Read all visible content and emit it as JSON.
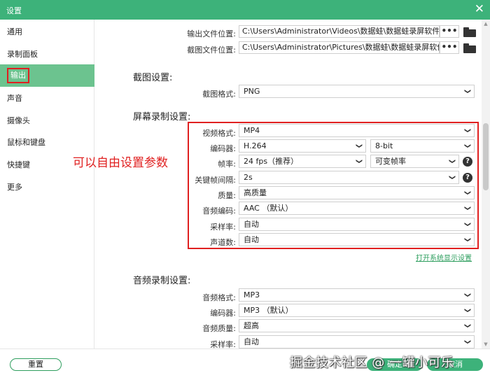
{
  "window": {
    "title": "设置",
    "close_glyph": "✕",
    "accent_color": "#3db27a"
  },
  "sidebar": {
    "items": [
      {
        "label": "通用"
      },
      {
        "label": "录制面板"
      },
      {
        "label": "输出",
        "active": true
      },
      {
        "label": "声音"
      },
      {
        "label": "摄像头"
      },
      {
        "label": "鼠标和键盘"
      },
      {
        "label": "快捷键"
      },
      {
        "label": "更多"
      }
    ]
  },
  "paths": {
    "output_label": "输出文件位置:",
    "output_value": "C:\\Users\\Administrator\\Videos\\数据蛙\\数据蛙录屏软件",
    "screenshot_label": "截图文件位置:",
    "screenshot_value": "C:\\Users\\Administrator\\Pictures\\数据蛙\\数据蛙录屏软件",
    "browse_glyph": "•••"
  },
  "screenshot_settings": {
    "title": "截图设置:",
    "format_label": "截图格式:",
    "format_value": "PNG"
  },
  "screen_recording": {
    "title": "屏幕录制设置:",
    "video_format_label": "视频格式:",
    "video_format_value": "MP4",
    "encoder_label": "编码器:",
    "encoder_value": "H.264",
    "bitdepth_value": "8-bit",
    "framerate_label": "帧率:",
    "framerate_value": "24 fps（推荐）",
    "framerate_mode_value": "可变帧率",
    "keyframe_label": "关键帧间隔:",
    "keyframe_value": "2s",
    "quality_label": "质量:",
    "quality_value": "高质量",
    "audio_codec_label": "音频编码:",
    "audio_codec_value": "AAC （默认）",
    "sample_rate_label": "采样率:",
    "sample_rate_value": "自动",
    "channels_label": "声道数:",
    "channels_value": "自动",
    "display_settings_link": "打开系统显示设置"
  },
  "annotation": {
    "text": "可以自由设置参数",
    "color": "#e02020"
  },
  "audio_recording": {
    "title": "音频录制设置:",
    "format_label": "音频格式:",
    "format_value": "MP3",
    "encoder_label": "编码器:",
    "encoder_value": "MP3 （默认）",
    "quality_label": "音频质量:",
    "quality_value": "超高",
    "sample_rate_label": "采样率:",
    "sample_rate_value": "自动"
  },
  "footer": {
    "reset_label": "重置",
    "ok_label": "确定",
    "cancel_label": "取消",
    "watermark": "掘金技术社区 @ 一罐小可乐"
  },
  "icons": {
    "chevron": "chevron-down-icon",
    "help": "help-icon",
    "folder": "folder-icon",
    "close": "close-icon"
  }
}
